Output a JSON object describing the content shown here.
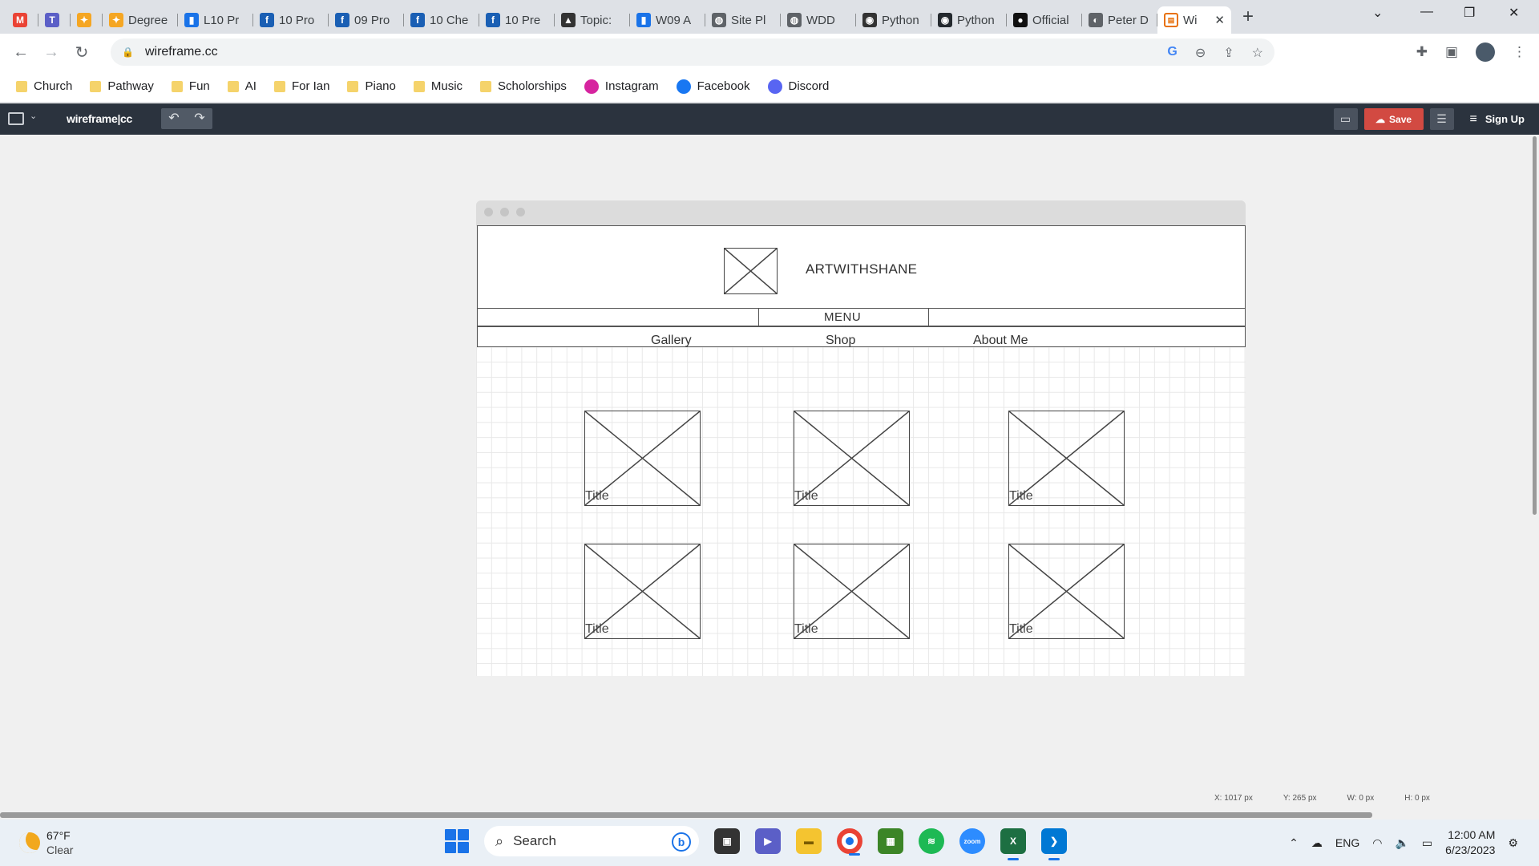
{
  "browser": {
    "tabs": [
      {
        "label": "",
        "icon": "gmail-icon",
        "color": "#ea4335",
        "glyph": "M"
      },
      {
        "label": "",
        "icon": "teams-icon",
        "color": "#5b5fc7",
        "glyph": "T"
      },
      {
        "label": "",
        "icon": "app-icon",
        "color": "#f5a623",
        "glyph": "✦"
      },
      {
        "label": "Degree",
        "icon": "degree-icon",
        "color": "#f5a623",
        "glyph": "✦"
      },
      {
        "label": "L10 Pr",
        "icon": "chart-icon",
        "color": "#1a73e8",
        "glyph": "▮"
      },
      {
        "label": "10 Pro",
        "icon": "formula-icon",
        "color": "#1a5fb4",
        "glyph": "f"
      },
      {
        "label": "09 Pro",
        "icon": "formula-icon",
        "color": "#1a5fb4",
        "glyph": "f"
      },
      {
        "label": "10 Che",
        "icon": "formula-icon",
        "color": "#1a5fb4",
        "glyph": "f"
      },
      {
        "label": "10 Pre",
        "icon": "formula-icon",
        "color": "#1a5fb4",
        "glyph": "f"
      },
      {
        "label": "Topic:",
        "icon": "topic-icon",
        "color": "#333333",
        "glyph": "▲"
      },
      {
        "label": "W09 A",
        "icon": "chart-icon",
        "color": "#1a73e8",
        "glyph": "▮"
      },
      {
        "label": "Site Pl",
        "icon": "globe-icon",
        "color": "#5f6368",
        "glyph": "◍"
      },
      {
        "label": "WDD",
        "icon": "globe-icon",
        "color": "#5f6368",
        "glyph": "◍"
      },
      {
        "label": "Python",
        "icon": "python-icon",
        "color": "#333333",
        "glyph": "◉"
      },
      {
        "label": "Python",
        "icon": "github-icon",
        "color": "#24292e",
        "glyph": "◉"
      },
      {
        "label": "Official",
        "icon": "official-icon",
        "color": "#111111",
        "glyph": "●"
      },
      {
        "label": "Peter D",
        "icon": "peter-icon",
        "color": "#5f6368",
        "glyph": "◐"
      }
    ],
    "active_tab": {
      "label": "Wi",
      "icon": "wireframe-icon",
      "color": "#e8710a"
    },
    "url": "wireframe.cc",
    "bookmarks": [
      {
        "label": "Church",
        "type": "folder"
      },
      {
        "label": "Pathway",
        "type": "folder"
      },
      {
        "label": "Fun",
        "type": "folder"
      },
      {
        "label": "AI",
        "type": "folder"
      },
      {
        "label": "For Ian",
        "type": "folder"
      },
      {
        "label": "Piano",
        "type": "folder"
      },
      {
        "label": "Music",
        "type": "folder"
      },
      {
        "label": "Scholorships",
        "type": "folder"
      },
      {
        "label": "Instagram",
        "type": "link",
        "color": "#d6249f"
      },
      {
        "label": "Facebook",
        "type": "link",
        "color": "#1877f2"
      },
      {
        "label": "Discord",
        "type": "link",
        "color": "#5865f2"
      }
    ]
  },
  "app": {
    "brand": "wireframe|cc",
    "save_label": "Save",
    "signup_label": "Sign Up",
    "accent": "#d24a42"
  },
  "wireframe": {
    "site_name": "ARTWITHSHANE",
    "menu_label": "MENU",
    "nav": [
      "Gallery",
      "Shop",
      "About Me"
    ],
    "card_titles": [
      "Title",
      "Title",
      "Title",
      "Title",
      "Title",
      "Title"
    ]
  },
  "status": {
    "x": "X: 1017 px",
    "y": "Y: 265 px",
    "w": "W: 0 px",
    "h": "H: 0 px"
  },
  "taskbar": {
    "temp": "67°F",
    "condition": "Clear",
    "search_placeholder": "Search",
    "lang": "ENG",
    "time": "12:00 AM",
    "date": "6/23/2023"
  }
}
